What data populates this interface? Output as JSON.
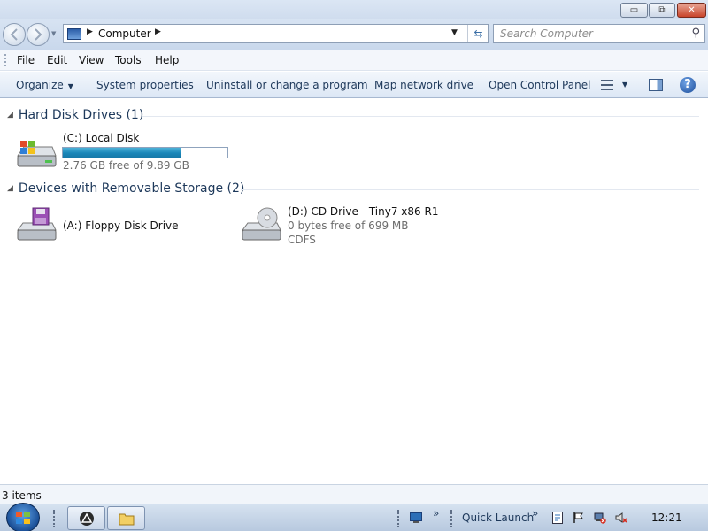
{
  "window": {
    "min_glyph": "▭",
    "max_glyph": "⧉",
    "close_glyph": "✕"
  },
  "address": {
    "crumb": "Computer",
    "search_placeholder": "Search Computer"
  },
  "menu": {
    "file": "F",
    "file_rest": "ile",
    "edit": "E",
    "edit_rest": "dit",
    "view": "V",
    "view_rest": "iew",
    "tools": "T",
    "tools_rest": "ools",
    "help": "H",
    "help_rest": "elp"
  },
  "toolbar": {
    "organize": "Organize",
    "system_properties": "System properties",
    "uninstall": "Uninstall or change a program",
    "map_drive": "Map network drive",
    "control_panel": "Open Control Panel",
    "help_glyph": "?"
  },
  "groups": {
    "hard_disk": {
      "title": "Hard Disk Drives (1)",
      "drives": [
        {
          "name": "(C:) Local Disk",
          "free": "2.76 GB free of 9.89 GB",
          "used_fraction": 0.72
        }
      ]
    },
    "removable": {
      "title": "Devices with Removable Storage (2)",
      "drives": [
        {
          "name": "(A:) Floppy Disk Drive"
        },
        {
          "name": "(D:) CD Drive - Tiny7 x86 R1",
          "free": "0 bytes free of 699 MB",
          "fs": "CDFS"
        }
      ]
    }
  },
  "status": {
    "items": "3 items"
  },
  "taskbar": {
    "quick_launch": "Quick Launch",
    "chevron": "»",
    "clock": "12:21"
  },
  "colors": {
    "accent": "#1a86b8",
    "title_bar": "#cfdcee",
    "close": "#c9442a"
  }
}
